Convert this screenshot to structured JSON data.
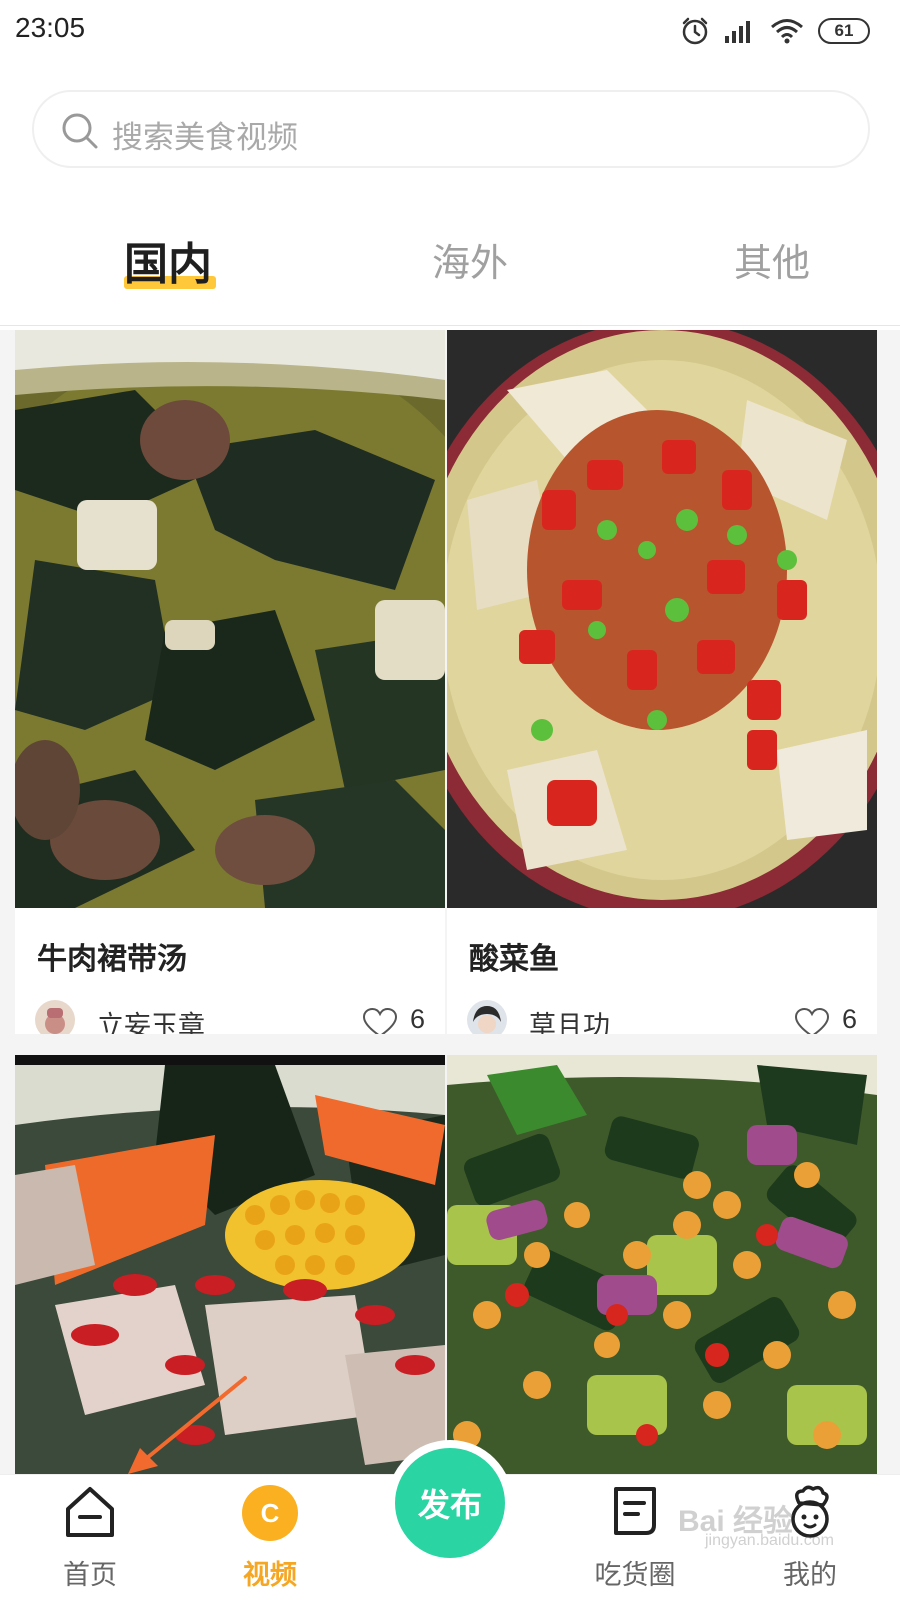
{
  "status_bar": {
    "time": "23:05",
    "battery": "61"
  },
  "search": {
    "placeholder": "搜索美食视频"
  },
  "tabs": [
    {
      "label": "国内",
      "active": true
    },
    {
      "label": "海外",
      "active": false
    },
    {
      "label": "其他",
      "active": false
    }
  ],
  "cards": [
    {
      "title": "牛肉裙带汤",
      "author": "立妄玉章",
      "likes": "6"
    },
    {
      "title": "酸菜鱼",
      "author": "草且功",
      "likes": "6"
    }
  ],
  "bottom_nav": {
    "home": "首页",
    "video": "视频",
    "video_badge": "C",
    "publish": "发布",
    "foodie_circle": "吃货圈",
    "me": "我的"
  },
  "watermark": {
    "text": "Bai 经验",
    "sub": "jingyan.baidu.com"
  },
  "colors": {
    "accent": "#fbb021",
    "publish": "#2bd4a3",
    "tab_underline": "#ffc73a",
    "annotation_arrow": "#f26a2e"
  }
}
